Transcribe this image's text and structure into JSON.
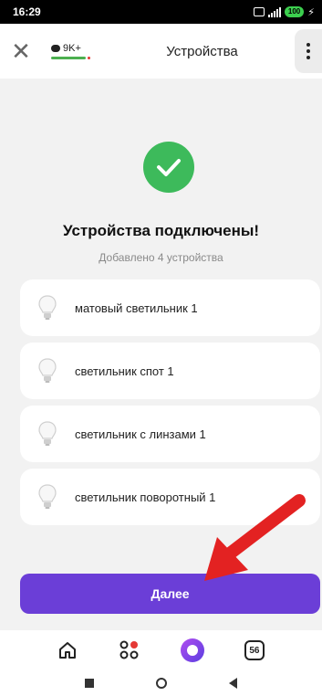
{
  "status_bar": {
    "time": "16:29",
    "battery": "100"
  },
  "header": {
    "counter_badge": "9K+",
    "title": "Устройства"
  },
  "success": {
    "title": "Устройства подключены!",
    "subtitle": "Добавлено 4 устройства"
  },
  "devices": [
    {
      "name": "матовый светильник 1",
      "icon": "bulb-icon"
    },
    {
      "name": "светильник спот 1",
      "icon": "bulb-icon"
    },
    {
      "name": "светильник с линзами 1",
      "icon": "bulb-icon"
    },
    {
      "name": "светильник поворотный 1",
      "icon": "bulb-icon"
    }
  ],
  "next_button": {
    "label": "Далее"
  },
  "bottom_nav": {
    "tabs_count": "56"
  },
  "colors": {
    "accent": "#6b3ed7",
    "success": "#3dba5b",
    "arrow": "#e32222"
  }
}
